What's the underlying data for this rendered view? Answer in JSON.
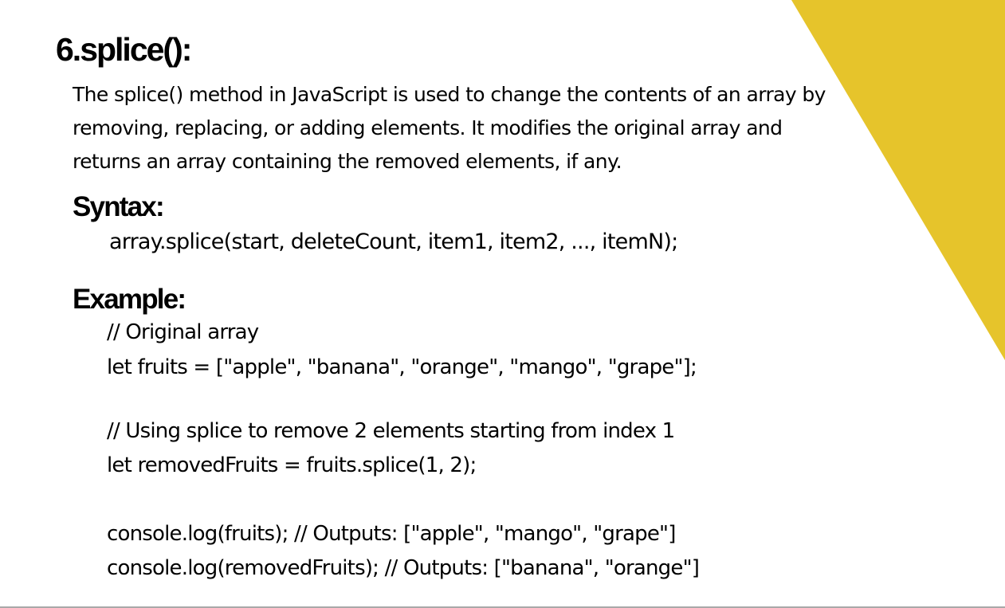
{
  "slide": {
    "title": "6.splice():",
    "accent_color": "#e6c42b",
    "intro": [
      "The splice() method in JavaScript is used to change the contents of an array by",
      "removing, replacing, or adding elements. It modifies the original array and",
      "returns an array containing the removed elements, if any."
    ],
    "syntax": {
      "heading": "Syntax:",
      "line": "array.splice(start, deleteCount, item1, item2, ..., itemN);"
    },
    "example": {
      "heading": "Example:",
      "lines": [
        "// Original array",
        "let fruits = [\"apple\", \"banana\", \"orange\", \"mango\", \"grape\"];",
        "// Using splice to remove 2 elements starting from index 1",
        "let removedFruits = fruits.splice(1, 2);",
        "console.log(fruits); // Outputs: [\"apple\", \"mango\", \"grape\"]",
        "console.log(removedFruits); // Outputs: [\"banana\", \"orange\"]"
      ]
    }
  }
}
